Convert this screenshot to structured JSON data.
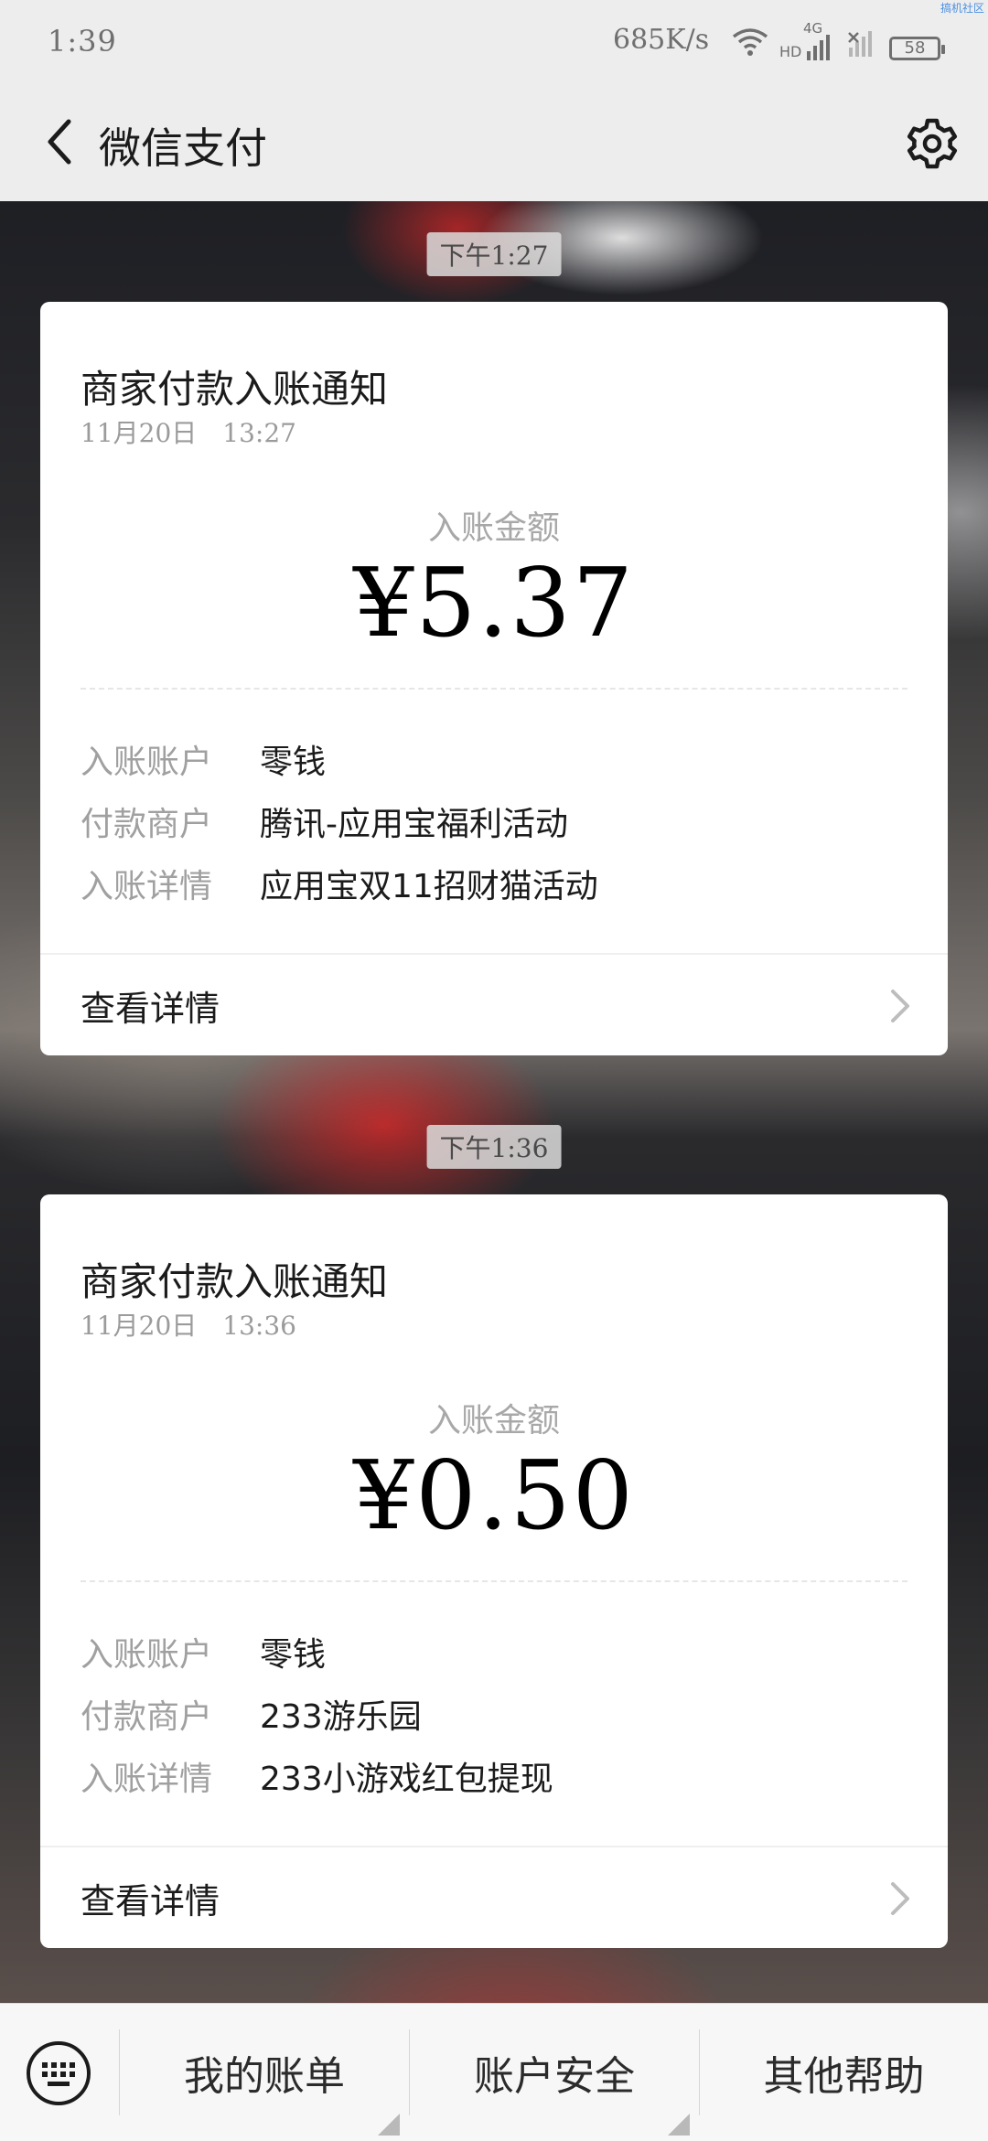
{
  "status_bar": {
    "time": "1:39",
    "net_speed": "685K/s",
    "network_label": "4G",
    "hd_label": "HD",
    "battery": "58",
    "watermark": "搞机社区"
  },
  "header": {
    "title": "微信支付",
    "back_icon": "chevron-left-icon",
    "settings_icon": "gear-icon"
  },
  "messages": [
    {
      "time_chip": "下午1:27",
      "title": "商家付款入账通知",
      "date": "11月20日　13:27",
      "amount_label": "入账金额",
      "amount": "¥5.37",
      "rows": [
        {
          "key": "入账账户",
          "value": "零钱"
        },
        {
          "key": "付款商户",
          "value": "腾讯-应用宝福利活动"
        },
        {
          "key": "入账详情",
          "value": "应用宝双11招财猫活动"
        }
      ],
      "link_label": "查看详情"
    },
    {
      "time_chip": "下午1:36",
      "title": "商家付款入账通知",
      "date": "11月20日　13:36",
      "amount_label": "入账金额",
      "amount": "¥0.50",
      "rows": [
        {
          "key": "入账账户",
          "value": "零钱"
        },
        {
          "key": "付款商户",
          "value": "233游乐园"
        },
        {
          "key": "入账详情",
          "value": "233小游戏红包提现"
        }
      ],
      "link_label": "查看详情"
    }
  ],
  "bottom_menu": {
    "keyboard_icon": "keyboard-icon",
    "items": [
      "我的账单",
      "账户安全",
      "其他帮助"
    ]
  },
  "colors": {
    "header_bg": "#ededed",
    "card_bg": "#ffffff",
    "muted_text": "#a0a0a0",
    "primary_text": "#1b1b1b"
  }
}
